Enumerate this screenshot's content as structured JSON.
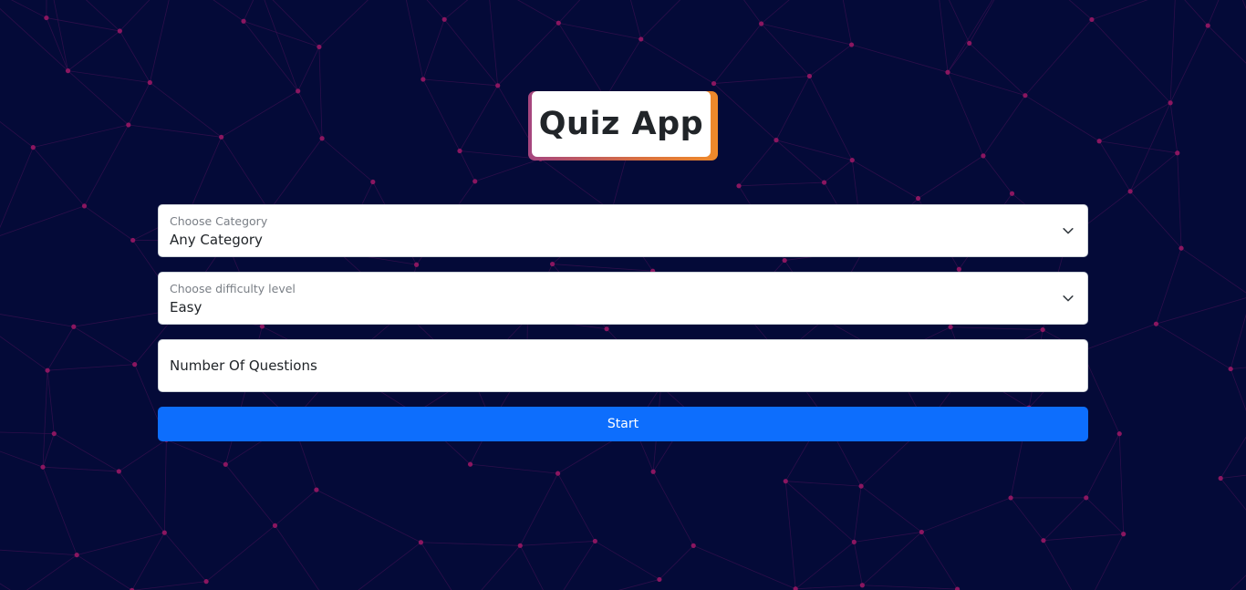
{
  "app": {
    "title": "Quiz App"
  },
  "form": {
    "category": {
      "label": "Choose Category",
      "selected": "Any Category"
    },
    "difficulty": {
      "label": "Choose difficulty level",
      "selected": "Easy"
    },
    "questions": {
      "placeholder": "Number Of Questions",
      "value": ""
    },
    "start_label": "Start"
  },
  "icons": {
    "dropdown": "chevron-down-icon"
  },
  "colors": {
    "background": "#040a38",
    "network_lines": "#3a1050",
    "network_dots": "#8a1660",
    "primary": "#0d6efd",
    "title_accent_start": "#a5457f",
    "title_accent_end": "#ef8a2a"
  }
}
